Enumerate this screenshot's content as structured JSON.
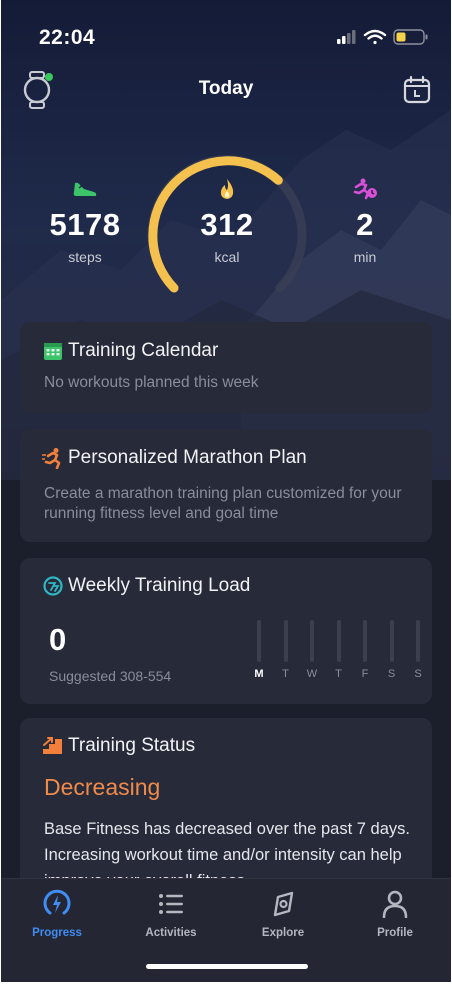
{
  "status_bar": {
    "time": "22:04"
  },
  "header": {
    "title": "Today"
  },
  "activity": {
    "steps": {
      "value": "5178",
      "unit": "steps"
    },
    "kcal": {
      "value": "312",
      "unit": "kcal"
    },
    "minutes": {
      "value": "2",
      "unit": "min"
    },
    "ring_progress": 0.66
  },
  "cards": {
    "calendar": {
      "title": "Training Calendar",
      "subtitle": "No workouts planned this week"
    },
    "marathon": {
      "title": "Personalized Marathon Plan",
      "subtitle": "Create a marathon training plan customized for your running fitness level and goal time"
    },
    "load": {
      "title": "Weekly Training Load",
      "value": "0",
      "suggested": "Suggested 308-554",
      "days": [
        "M",
        "T",
        "W",
        "T",
        "F",
        "S",
        "S"
      ]
    },
    "status": {
      "title": "Training Status",
      "state": "Decreasing",
      "description": "Base Fitness has decreased over the past 7 days. Increasing workout time and/or intensity can help improve your overall fitness."
    }
  },
  "tabs": [
    {
      "label": "Progress",
      "icon": "progress-icon",
      "active": true
    },
    {
      "label": "Activities",
      "icon": "list-icon",
      "active": false
    },
    {
      "label": "Explore",
      "icon": "compass-icon",
      "active": false
    },
    {
      "label": "Profile",
      "icon": "person-icon",
      "active": false
    }
  ],
  "colors": {
    "accent_blue": "#3f8cf2",
    "ring_yellow": "#f4c14f",
    "status_orange": "#f08a4b",
    "steps_green": "#3cc46a",
    "minutes_magenta": "#d94fd8"
  }
}
